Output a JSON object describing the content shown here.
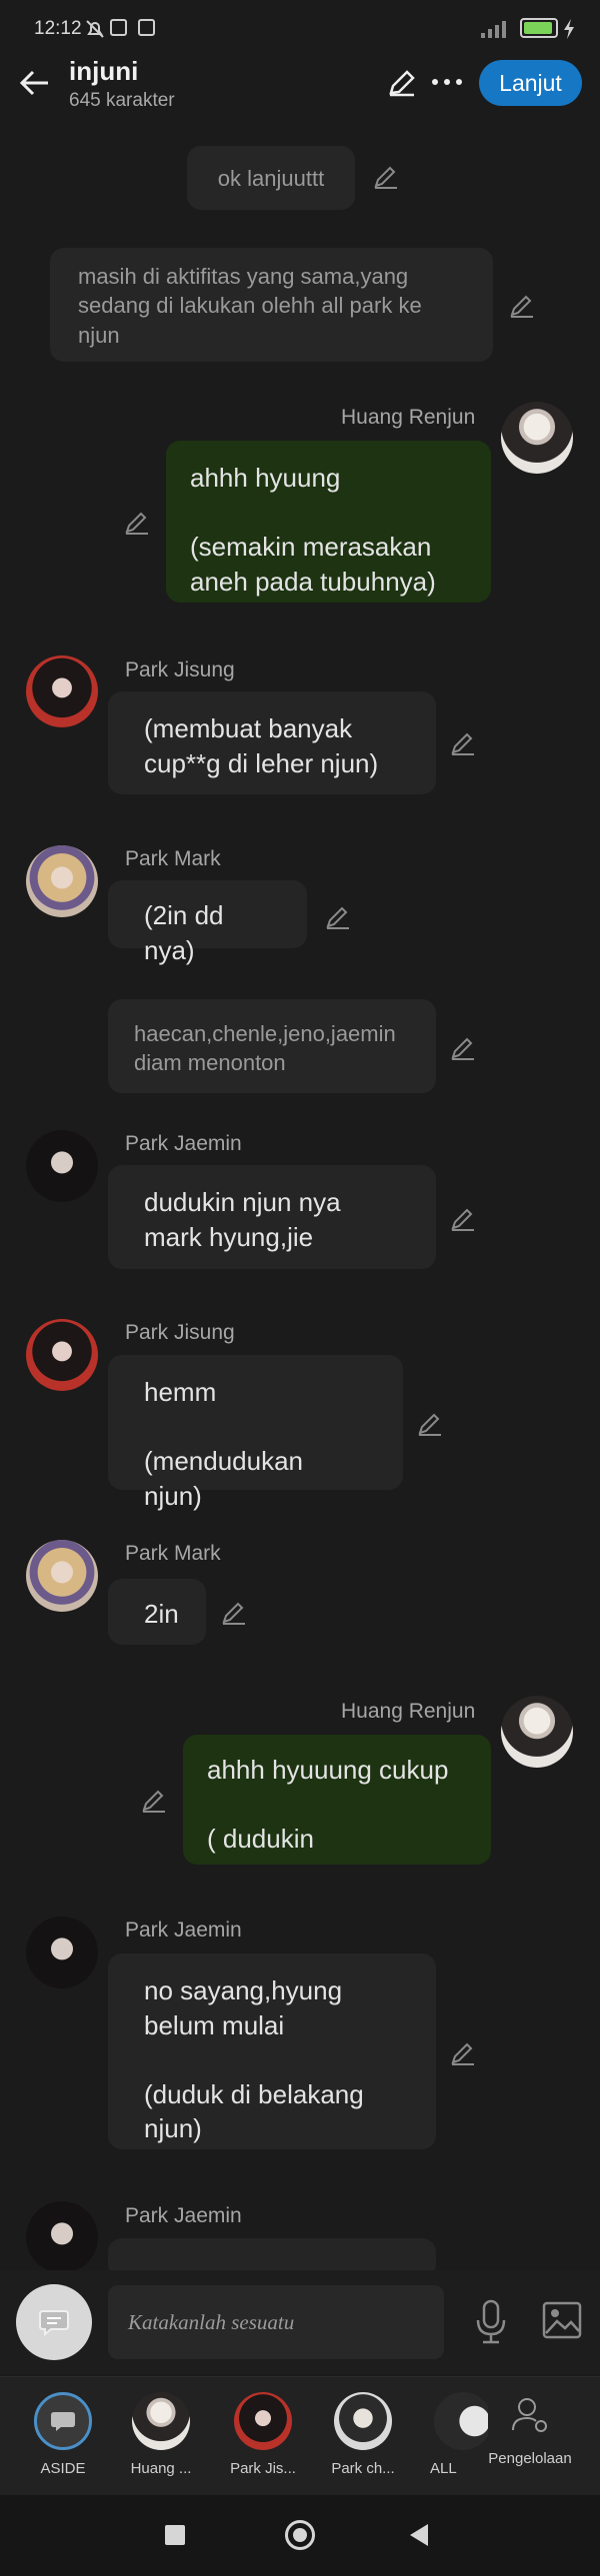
{
  "status": {
    "time": "12:12"
  },
  "header": {
    "title": "injuni",
    "subtitle": "645 karakter",
    "next_label": "Lanjut"
  },
  "messages": [
    {
      "kind": "narration",
      "text": "ok lanjuuttt"
    },
    {
      "kind": "narration",
      "text": "masih di aktifitas yang sama,yang sedang di lakukan olehh all park ke njun"
    },
    {
      "kind": "user",
      "name": "Huang Renjun",
      "text": "ahhh hyuung\n\n(semakin merasakan aneh pada tubuhnya)"
    },
    {
      "kind": "char",
      "name": "Park Jisung",
      "text": "(membuat banyak cup**g di leher njun)"
    },
    {
      "kind": "char",
      "name": "Park Mark",
      "text": "(2in dd nya)"
    },
    {
      "kind": "narration",
      "text": "haecan,chenle,jeno,jaemin diam menonton"
    },
    {
      "kind": "char",
      "name": "Park Jaemin",
      "text": "dudukin njun nya mark hyung,jie"
    },
    {
      "kind": "char",
      "name": "Park Jisung",
      "text": "hemm\n\n(mendudukan njun)"
    },
    {
      "kind": "char",
      "name": "Park Mark",
      "text": "2in"
    },
    {
      "kind": "user",
      "name": "Huang Renjun",
      "text": "ahhh hyuuung cukup\n\n( dudukin"
    },
    {
      "kind": "char",
      "name": "Park Jaemin",
      "text": "no sayang,hyung belum mulai\n\n(duduk di belakang njun)"
    },
    {
      "kind": "char",
      "name": "Park Jaemin",
      "text": ""
    }
  ],
  "composer": {
    "placeholder": "Katakanlah sesuatu"
  },
  "tabs": [
    {
      "label": "ASIDE"
    },
    {
      "label": "Huang ..."
    },
    {
      "label": "Park Jis..."
    },
    {
      "label": "Park ch..."
    },
    {
      "label": "ALL"
    },
    {
      "label": "Pengelolaan"
    }
  ],
  "colors": {
    "accent": "#1677c4",
    "user_bubble": "#1d3312",
    "char_bubble": "#252525",
    "background": "#1b1b1b"
  }
}
